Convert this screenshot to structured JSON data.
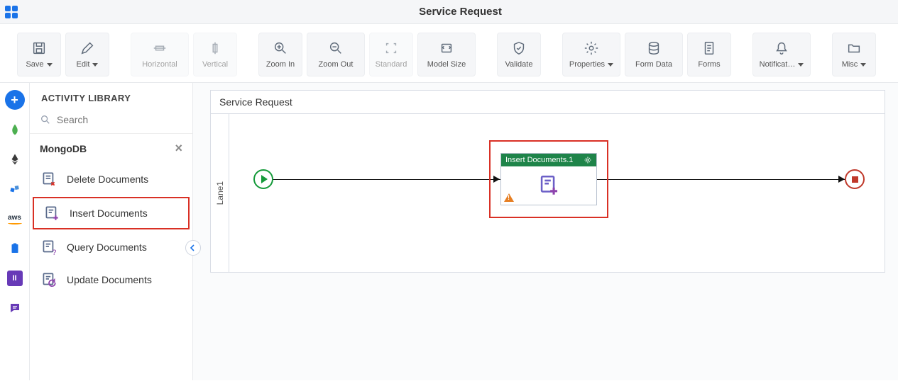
{
  "header": {
    "title": "Service Request"
  },
  "toolbar": {
    "save": "Save",
    "edit": "Edit",
    "horizontal": "Horizontal",
    "vertical": "Vertical",
    "zoom_in": "Zoom In",
    "zoom_out": "Zoom Out",
    "standard": "Standard",
    "model_size": "Model Size",
    "validate": "Validate",
    "properties": "Properties",
    "form_data": "Form Data",
    "forms": "Forms",
    "notifications": "Notificat…",
    "misc": "Misc"
  },
  "sidebar": {
    "heading": "ACTIVITY LIBRARY",
    "search_placeholder": "Search",
    "group": "MongoDB",
    "items": [
      {
        "label": "Delete Documents"
      },
      {
        "label": "Insert Documents"
      },
      {
        "label": "Query Documents"
      },
      {
        "label": "Update Documents"
      }
    ]
  },
  "canvas": {
    "title": "Service Request",
    "lane": "Lane1",
    "node_title": "Insert Documents.1"
  }
}
